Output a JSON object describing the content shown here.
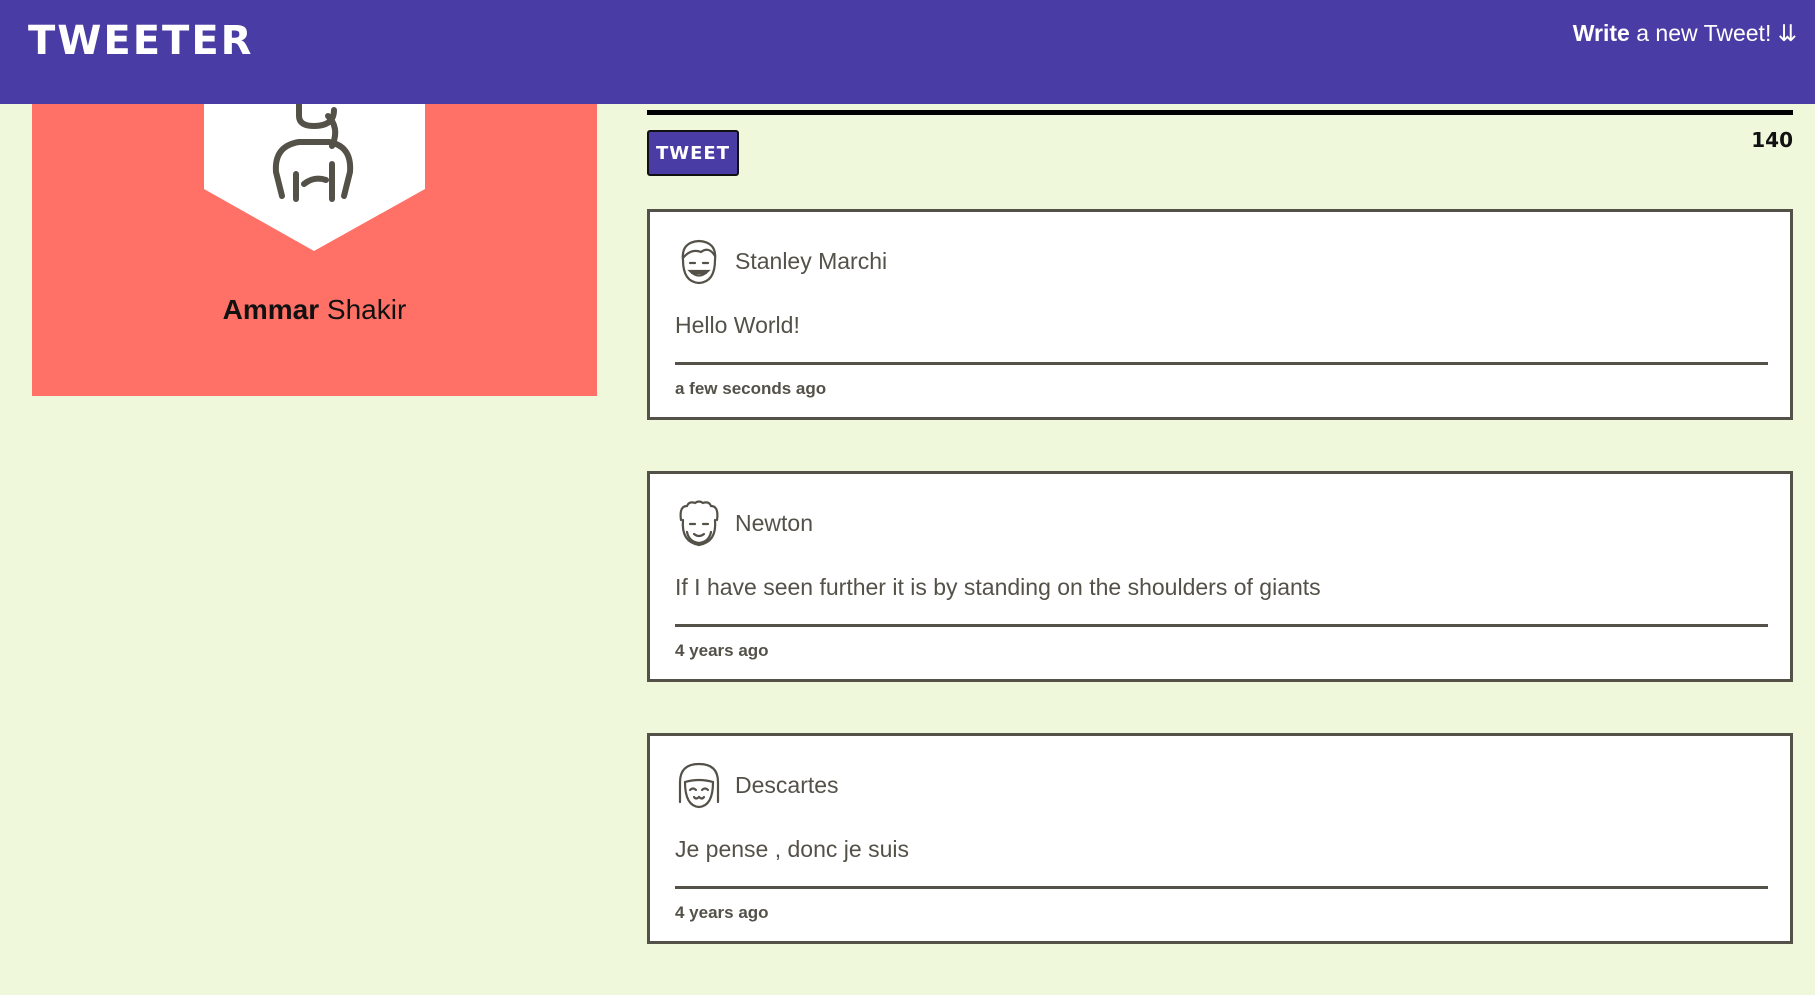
{
  "nav": {
    "brand": "TWEETER",
    "compose_bold": "Write",
    "compose_rest": " a new Tweet! ⇊"
  },
  "profile": {
    "first_name": "Ammar",
    "last_name": " Shakir"
  },
  "composer": {
    "tweet_button": "TWEET",
    "counter": "140"
  },
  "tweets": [
    {
      "author": "Stanley Marchi",
      "text": "Hello World!",
      "time": "a few seconds ago"
    },
    {
      "author": "Newton",
      "text": "If I have seen further it is by standing on the shoulders of giants",
      "time": "4 years ago"
    },
    {
      "author": "Descartes",
      "text": "Je pense , donc je suis",
      "time": "4 years ago"
    }
  ],
  "colors": {
    "nav_bg": "#4a3ca5",
    "page_bg": "#f0f8dc",
    "profile_bg": "#ff7166",
    "text": "#545149"
  }
}
